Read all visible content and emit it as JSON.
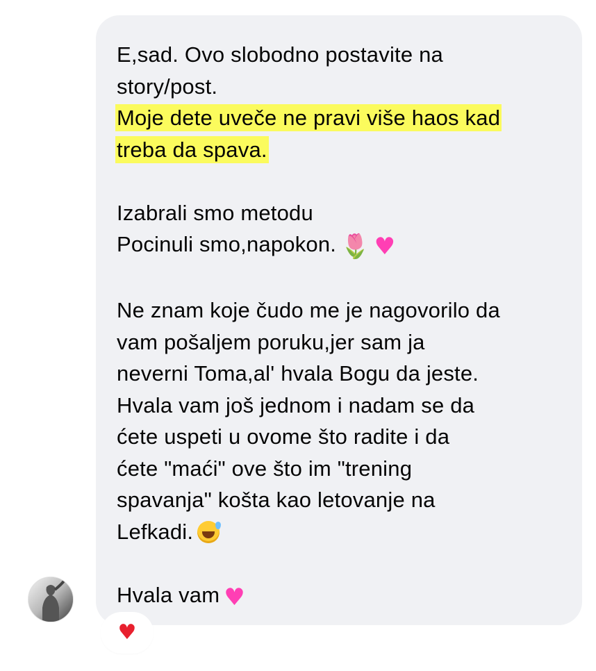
{
  "message": {
    "lines": [
      "E,sad. Ovo slobodno postavite na",
      "story/post.",
      "Moje dete uveče ne pravi više haos kad",
      "treba da spava.",
      "",
      "Izabrali smo metodu",
      "Pocinuli smo,napokon.",
      "",
      "Ne znam koje čudo me je nagovorilo da",
      "vam pošaljem poruku,jer sam ja",
      "neverni Toma,al' hvala Bogu da jeste.",
      "Hvala vam još jednom i nadam se da",
      "ćete uspeti u ovome što radite i da",
      "ćete \"maći\" ove što im \"trening",
      "spavanja\" košta kao letovanje na",
      "Lefkadi.",
      "",
      "Hvala vam"
    ],
    "highlight_color": "#fbfb5d",
    "bubble_color": "#f0f1f4",
    "text_color": "#050505"
  },
  "emojis": {
    "tulip": "🌷",
    "heart_pink": "♥",
    "grin_sweat": "grinning-sweat-emoji",
    "heart_red": "♥"
  },
  "reaction": {
    "icon": "red-heart-icon",
    "color": "#e8202e"
  },
  "avatar": {
    "icon": "user-avatar-photo"
  }
}
